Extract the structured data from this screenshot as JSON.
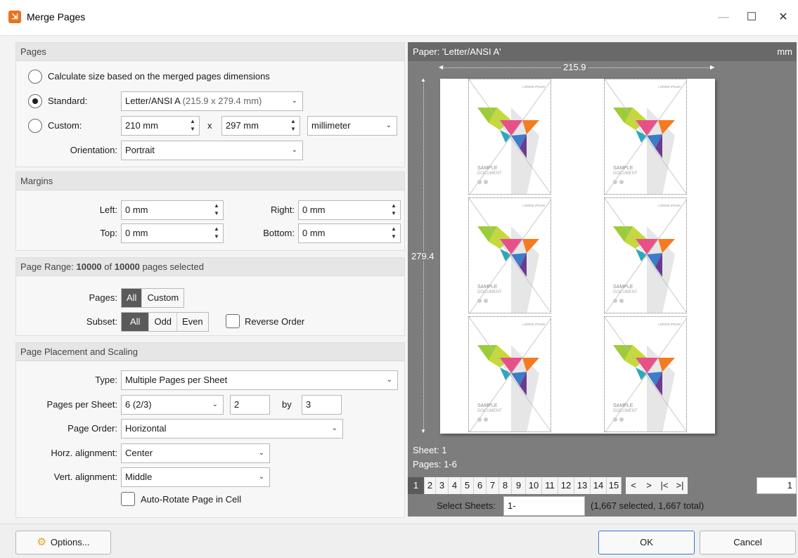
{
  "window": {
    "title": "Merge Pages",
    "app_icon": "merge-app-icon",
    "minimize": "—",
    "maximize": "☐",
    "close": "✕"
  },
  "pages_group": {
    "header": "Pages",
    "calc_label": "Calculate size based on the merged pages dimensions",
    "standard_label": "Standard:",
    "standard_value": "Letter/ANSI A",
    "standard_detail": "(215.9 x 279.4 mm)",
    "custom_label": "Custom:",
    "custom_width": "210 mm",
    "by_x": "x",
    "custom_height": "297 mm",
    "unit": "millimeter",
    "orientation_label": "Orientation:",
    "orientation": "Portrait",
    "selected": "standard"
  },
  "margins_group": {
    "header": "Margins",
    "left_label": "Left:",
    "left": "0 mm",
    "right_label": "Right:",
    "right": "0 mm",
    "top_label": "Top:",
    "top": "0 mm",
    "bottom_label": "Bottom:",
    "bottom": "0 mm"
  },
  "range_group": {
    "header_prefix": "Page Range: ",
    "selected_count": "10000",
    "of": " of ",
    "total_count": "10000",
    "suffix": " pages selected",
    "pages_label": "Pages:",
    "pages_all": "All",
    "pages_custom": "Custom",
    "subset_label": "Subset:",
    "subset_all": "All",
    "subset_odd": "Odd",
    "subset_even": "Even",
    "reverse_label": "Reverse Order",
    "reverse_checked": false
  },
  "placement_group": {
    "header": "Page Placement and Scaling",
    "type_label": "Type:",
    "type": "Multiple Pages per Sheet",
    "pps_label": "Pages per Sheet:",
    "pps": "6 (2/3)",
    "cols": "2",
    "by": "by",
    "rows": "3",
    "order_label": "Page Order:",
    "order": "Horizontal",
    "horz_label": "Horz. alignment:",
    "horz": "Center",
    "vert_label": "Vert. alignment:",
    "vert": "Middle",
    "autorotate_label": "Auto-Rotate Page in Cell",
    "autorotate_checked": false
  },
  "preview": {
    "paper_label": "Paper: 'Letter/ANSI A'",
    "unit": "mm",
    "width": "215.9",
    "height": "279.4",
    "thumb_heading": "LOREM IPSUM",
    "thumb_title_1": "SAMPLE",
    "thumb_title_2": "DOCUMENT",
    "sheet_label": "Sheet: 1",
    "pages_label": "Pages: 1-6",
    "pager": [
      "1",
      "2",
      "3",
      "4",
      "5",
      "6",
      "7",
      "8",
      "9",
      "10",
      "11",
      "12",
      "13",
      "14",
      "15"
    ],
    "pager_current": "1",
    "nav_prev": "<",
    "nav_next": ">",
    "nav_first": "|<",
    "nav_last": ">|",
    "page_input": "1"
  },
  "select_sheets": {
    "label": "Select Sheets:",
    "value": "1-",
    "summary": "(1,667 selected, 1,667 total)"
  },
  "buttons": {
    "options": "Options...",
    "ok": "OK",
    "cancel": "Cancel"
  },
  "colors": {
    "accent": "#3a78d0",
    "selected_segment": "#5a5a5a",
    "preview_bg": "#7d7d7d"
  }
}
